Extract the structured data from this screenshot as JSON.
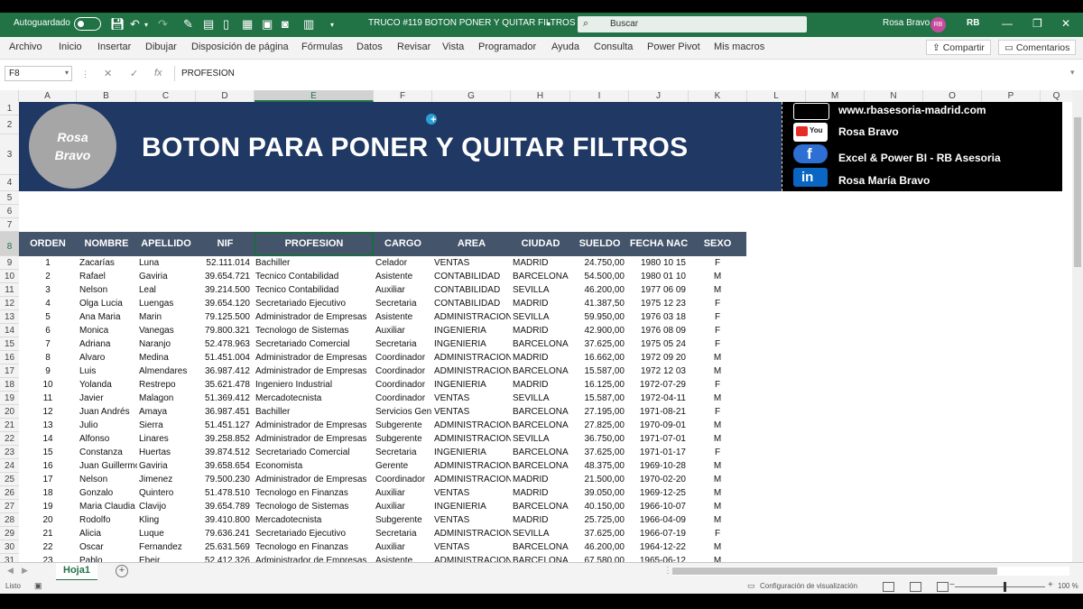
{
  "title_bar": {
    "autosave_label": "Autoguardado",
    "doc_title": "TRUCO #119 BOTON PONER Y QUITAR FILTROS",
    "search_placeholder": "Buscar",
    "user_name": "Rosa Bravo",
    "user_initials": "RB",
    "quick_access_icons": [
      "save-icon",
      "undo-icon",
      "redo-icon",
      "brush-icon",
      "form-icon",
      "new-file-icon",
      "table-icon",
      "camera-icon",
      "data-form-icon",
      "chevron-down-icon"
    ]
  },
  "menu": {
    "items": [
      "Archivo",
      "Inicio",
      "Insertar",
      "Dibujar",
      "Disposición de página",
      "Fórmulas",
      "Datos",
      "Revisar",
      "Vista",
      "Programador",
      "Ayuda",
      "Consulta",
      "Power Pivot",
      "Mis macros"
    ],
    "share_label": "Compartir",
    "comments_label": "Comentarios"
  },
  "formula_bar": {
    "name_box": "F8",
    "formula": "PROFESION"
  },
  "columns": [
    "A",
    "B",
    "C",
    "D",
    "E",
    "F",
    "G",
    "H",
    "I",
    "J",
    "K",
    "L",
    "M",
    "N",
    "O",
    "P"
  ],
  "selected_column": "E",
  "banner": {
    "logo_line1": "Rosa",
    "logo_line2": "Bravo",
    "title": "BOTON PARA PONER Y QUITAR FILTROS",
    "social": [
      {
        "icon": "web-icon",
        "text": "www.rbasesoria-madrid.com"
      },
      {
        "icon": "youtube-icon",
        "text": "Rosa Bravo"
      },
      {
        "icon": "facebook-icon",
        "text": "Excel & Power BI - RB Asesoria"
      },
      {
        "icon": "linkedin-icon",
        "text": "Rosa María Bravo"
      }
    ]
  },
  "table": {
    "headers": [
      "ORDEN",
      "NOMBRE",
      "APELLIDO",
      "NIF",
      "PROFESION",
      "CARGO",
      "AREA",
      "CIUDAD",
      "SUELDO",
      "FECHA NAC",
      "SEXO"
    ],
    "rows": [
      [
        "1",
        "Zacarías",
        "Luna",
        "52.111.014",
        "Bachiller",
        "Celador",
        "VENTAS",
        "MADRID",
        "24.750,00",
        "1980 10 15",
        "F"
      ],
      [
        "2",
        "Rafael",
        "Gaviria",
        "39.654.721",
        "Tecnico Contabilidad",
        "Asistente",
        "CONTABILIDAD",
        "BARCELONA",
        "54.500,00",
        "1980 01 10",
        "M"
      ],
      [
        "3",
        "Nelson",
        "Leal",
        "39.214.500",
        "Tecnico Contabilidad",
        "Auxiliar",
        "CONTABILIDAD",
        "SEVILLA",
        "46.200,00",
        "1977 06 09",
        "M"
      ],
      [
        "4",
        "Olga Lucia",
        "Luengas",
        "39.654.120",
        "Secretariado Ejecutivo",
        "Secretaria",
        "CONTABILIDAD",
        "MADRID",
        "41.387,50",
        "1975 12 23",
        "F"
      ],
      [
        "5",
        "Ana Maria",
        "Marin",
        "79.125.500",
        "Administrador de Empresas",
        "Asistente",
        "ADMINISTRACION",
        "SEVILLA",
        "59.950,00",
        "1976 03 18",
        "F"
      ],
      [
        "6",
        "Monica",
        "Vanegas",
        "79.800.321",
        "Tecnologo de Sistemas",
        "Auxiliar",
        "INGENIERIA",
        "MADRID",
        "42.900,00",
        "1976 08 09",
        "F"
      ],
      [
        "7",
        "Adriana",
        "Naranjo",
        "52.478.963",
        "Secretariado Comercial",
        "Secretaria",
        "INGENIERIA",
        "BARCELONA",
        "37.625,00",
        "1975 05 24",
        "F"
      ],
      [
        "8",
        "Alvaro",
        "Medina",
        "51.451.004",
        "Administrador de Empresas",
        "Coordinador",
        "ADMINISTRACION",
        "MADRID",
        "16.662,00",
        "1972 09 20",
        "M"
      ],
      [
        "9",
        "Luis",
        "Almendares",
        "36.987.412",
        "Administrador de Empresas",
        "Coordinador",
        "ADMINISTRACION",
        "BARCELONA",
        "15.587,00",
        "1972 12 03",
        "M"
      ],
      [
        "10",
        "Yolanda",
        "Restrepo",
        "35.621.478",
        "Ingeniero Industrial",
        "Coordinador",
        "INGENIERIA",
        "MADRID",
        "16.125,00",
        "1972-07-29",
        "F"
      ],
      [
        "11",
        "Javier",
        "Malagon",
        "51.369.412",
        "Mercadotecnista",
        "Coordinador",
        "VENTAS",
        "SEVILLA",
        "15.587,00",
        "1972-04-11",
        "M"
      ],
      [
        "12",
        "Juan Andrés",
        "Amaya",
        "36.987.451",
        "Bachiller",
        "Servicios Generales",
        "VENTAS",
        "BARCELONA",
        "27.195,00",
        "1971-08-21",
        "F"
      ],
      [
        "13",
        "Julio",
        "Sierra",
        "51.451.127",
        "Administrador de Empresas",
        "Subgerente",
        "ADMINISTRACION",
        "BARCELONA",
        "27.825,00",
        "1970-09-01",
        "M"
      ],
      [
        "14",
        "Alfonso",
        "Linares",
        "39.258.852",
        "Administrador de Empresas",
        "Subgerente",
        "ADMINISTRACION",
        "SEVILLA",
        "36.750,00",
        "1971-07-01",
        "M"
      ],
      [
        "15",
        "Constanza",
        "Huertas",
        "39.874.512",
        "Secretariado Comercial",
        "Secretaria",
        "INGENIERIA",
        "BARCELONA",
        "37.625,00",
        "1971-01-17",
        "F"
      ],
      [
        "16",
        "Juan Guillermo",
        "Gaviria",
        "39.658.654",
        "Economista",
        "Gerente",
        "ADMINISTRACION",
        "BARCELONA",
        "48.375,00",
        "1969-10-28",
        "M"
      ],
      [
        "17",
        "Nelson",
        "Jimenez",
        "79.500.230",
        "Administrador de Empresas",
        "Coordinador",
        "ADMINISTRACION",
        "MADRID",
        "21.500,00",
        "1970-02-20",
        "M"
      ],
      [
        "18",
        "Gonzalo",
        "Quintero",
        "51.478.510",
        "Tecnologo en Finanzas",
        "Auxiliar",
        "VENTAS",
        "MADRID",
        "39.050,00",
        "1969-12-25",
        "M"
      ],
      [
        "19",
        "Maria Claudia",
        "Clavijo",
        "39.654.789",
        "Tecnologo de Sistemas",
        "Auxiliar",
        "INGENIERIA",
        "BARCELONA",
        "40.150,00",
        "1966-10-07",
        "M"
      ],
      [
        "20",
        "Rodolfo",
        "Kling",
        "39.410.800",
        "Mercadotecnista",
        "Subgerente",
        "VENTAS",
        "MADRID",
        "25.725,00",
        "1966-04-09",
        "M"
      ],
      [
        "21",
        "Alicia",
        "Luque",
        "79.636.241",
        "Secretariado Ejecutivo",
        "Secretaria",
        "ADMINISTRACION",
        "SEVILLA",
        "37.625,00",
        "1966-07-19",
        "F"
      ],
      [
        "22",
        "Oscar",
        "Fernandez",
        "25.631.569",
        "Tecnologo en Finanzas",
        "Auxiliar",
        "VENTAS",
        "BARCELONA",
        "46.200,00",
        "1964-12-22",
        "M"
      ],
      [
        "23",
        "Pablo",
        "Ebeir",
        "52.412.326",
        "Administrador de Empresas",
        "Asistente",
        "ADMINISTRACION",
        "BARCELONA",
        "67.580,00",
        "1965-06-12",
        "M"
      ]
    ]
  },
  "row_numbers": [
    "1",
    "2",
    "3",
    "4",
    "5",
    "6",
    "7",
    "8",
    "9",
    "10",
    "11",
    "12",
    "13",
    "14",
    "15",
    "16",
    "17",
    "18",
    "19",
    "20",
    "21",
    "22",
    "23",
    "24",
    "25",
    "26",
    "27",
    "28",
    "29",
    "30",
    "31"
  ],
  "sheet_tab": "Hoja1",
  "status": {
    "ready": "Listo",
    "display_settings": "Configuración de visualización",
    "zoom": "100 %"
  }
}
